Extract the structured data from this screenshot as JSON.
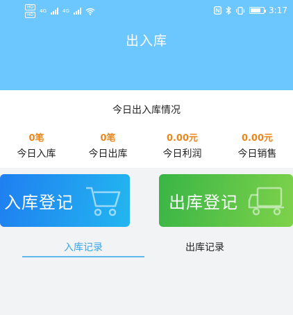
{
  "status_bar": {
    "hd1": "HD",
    "hd2": "HD",
    "net1": "4G",
    "net2": "4G",
    "time": "3:17"
  },
  "header": {
    "title": "出入库"
  },
  "summary": {
    "title": "今日出入库情况",
    "stats": [
      {
        "value": "0笔",
        "label": "今日入库"
      },
      {
        "value": "0笔",
        "label": "今日出库"
      },
      {
        "value": "0.00元",
        "label": "今日利润"
      },
      {
        "value": "0.00元",
        "label": "今日销售"
      }
    ]
  },
  "actions": {
    "in_label": "入库登记",
    "out_label": "出库登记"
  },
  "tabs": [
    {
      "label": "入库记录",
      "active": true
    },
    {
      "label": "出库记录",
      "active": false
    }
  ],
  "colors": {
    "header": "#6cc7ff",
    "value_orange": "#e8871e",
    "in_gradient_start": "#1f7ff0",
    "out_gradient_start": "#39b546",
    "active_tab": "#3aa6e6"
  }
}
